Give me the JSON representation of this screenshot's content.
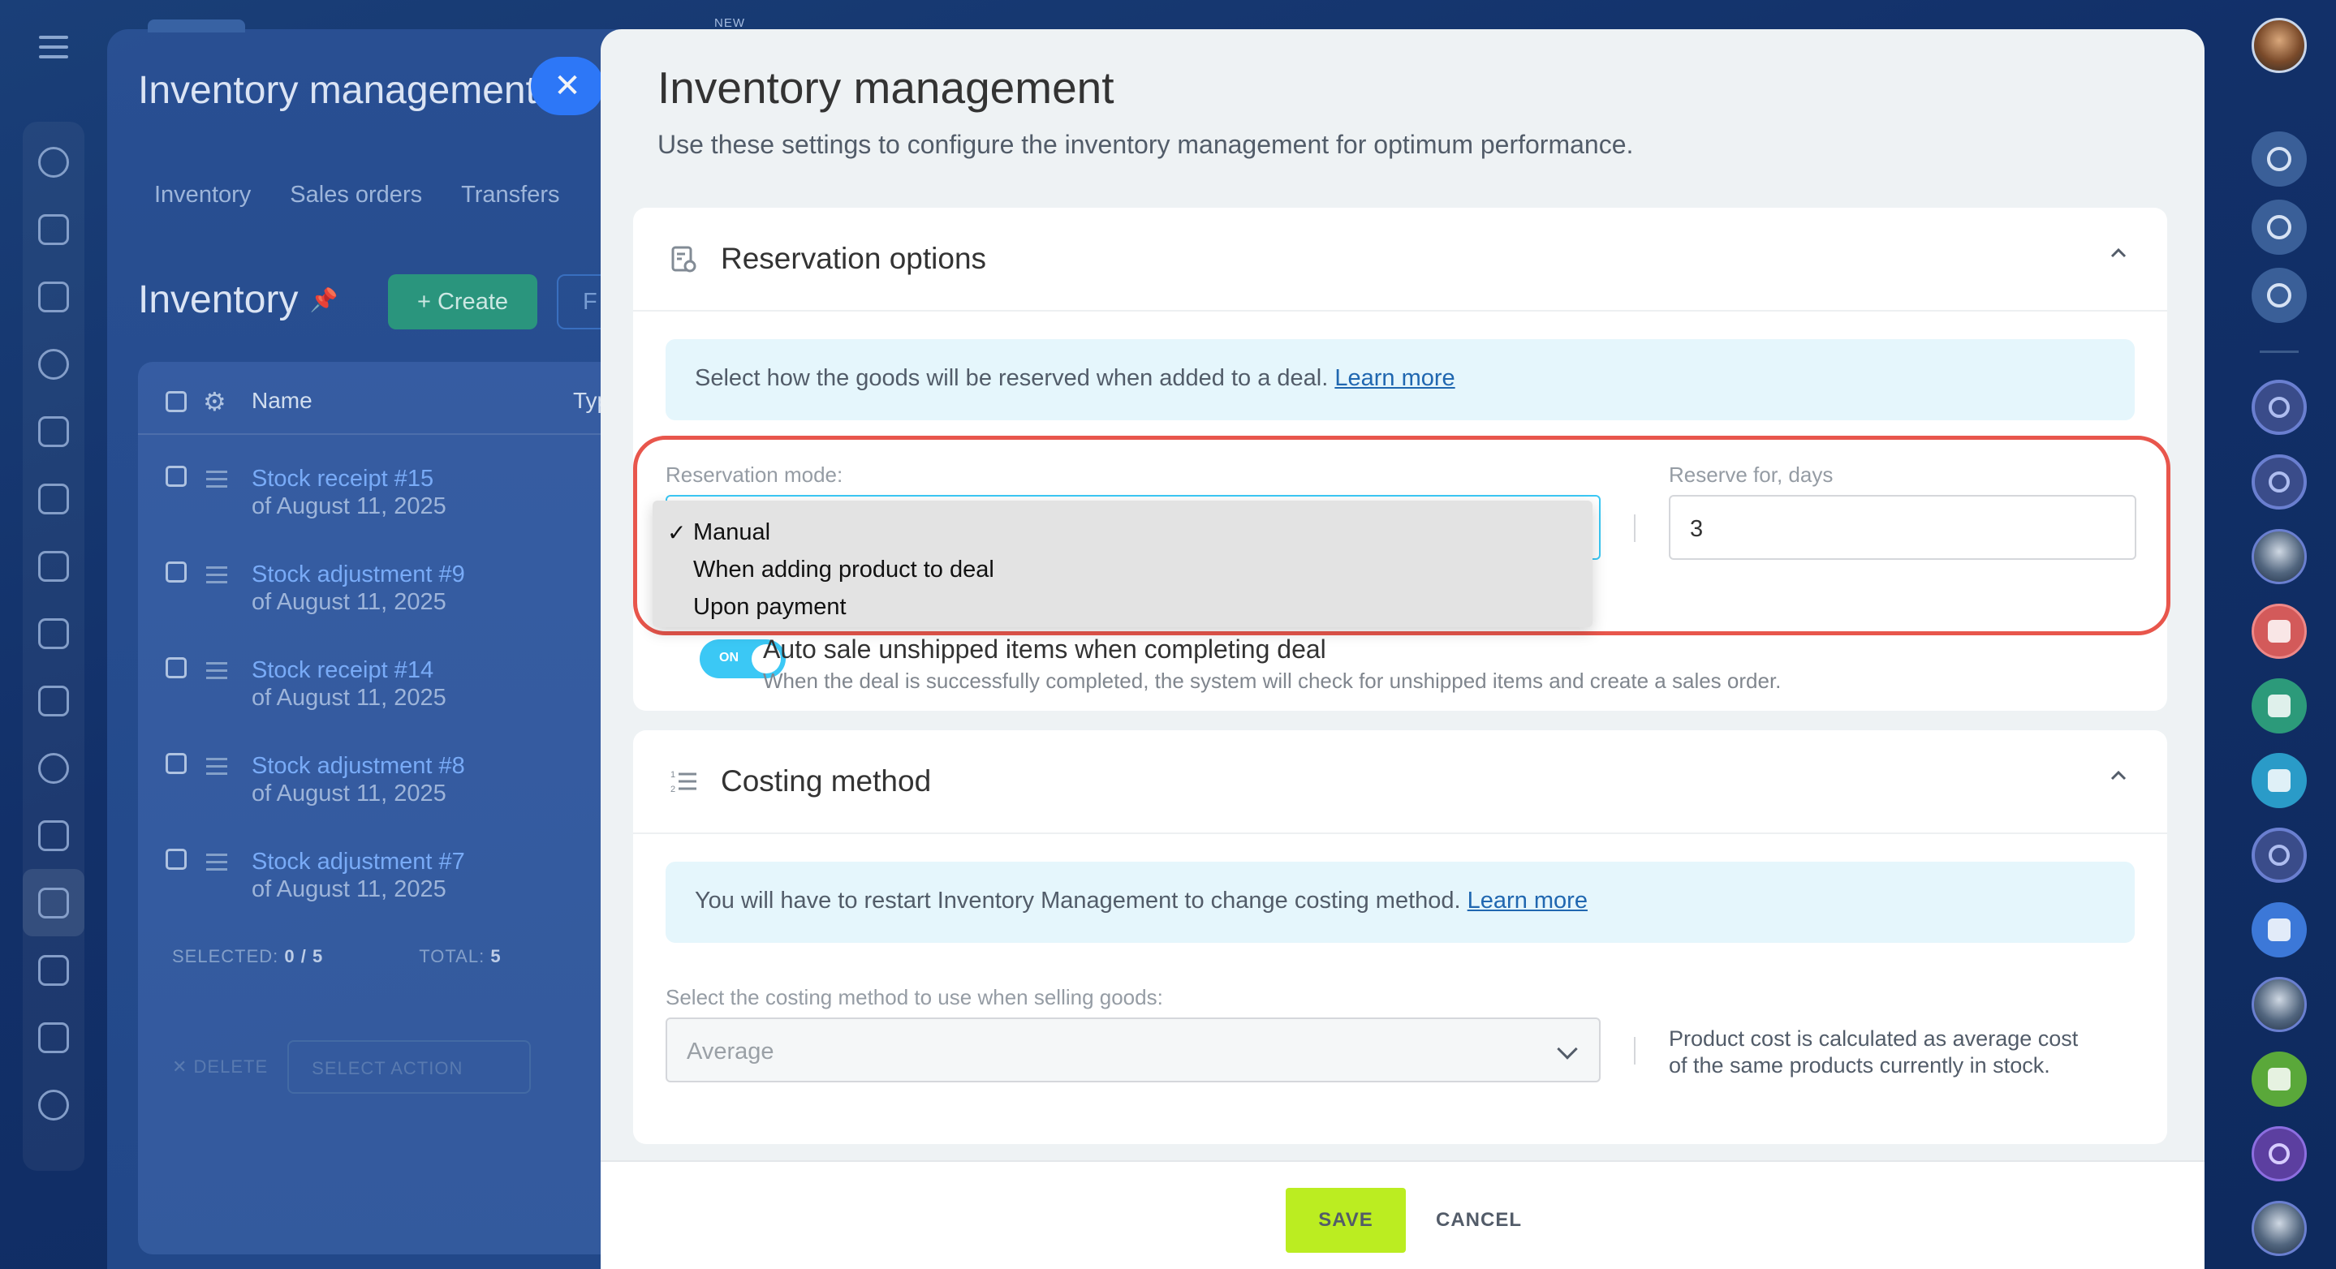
{
  "background": {
    "new_label": "NEW",
    "app_title": "Inventory management",
    "tabs": [
      "Inventory",
      "Sales orders",
      "Transfers"
    ],
    "page_title": "Inventory",
    "create_label": "+ Create",
    "filter_label": "F",
    "table": {
      "col_name": "Name",
      "col_type": "Typ",
      "rows": [
        {
          "title": "Stock receipt #15",
          "date": "of August 11, 2025"
        },
        {
          "title": "Stock adjustment #9",
          "date": "of August 11, 2025"
        },
        {
          "title": "Stock receipt #14",
          "date": "of August 11, 2025"
        },
        {
          "title": "Stock adjustment #8",
          "date": "of August 11, 2025"
        },
        {
          "title": "Stock adjustment #7",
          "date": "of August 11, 2025"
        }
      ],
      "selected_label": "SELECTED:",
      "selected_value": "0 / 5",
      "total_label": "TOTAL:",
      "total_value": "5",
      "delete_label": "✕ DELETE",
      "select_action_label": "SELECT ACTION"
    }
  },
  "panel": {
    "title": "Inventory management",
    "subtitle": "Use these settings to configure the inventory management for optimum performance.",
    "reservation": {
      "title": "Reservation options",
      "info_text": "Select how the goods will be reserved when added to a deal.",
      "info_link": "Learn more",
      "mode_label": "Reservation mode:",
      "mode_options": [
        "Manual",
        "When adding product to deal",
        "Upon payment"
      ],
      "mode_selected": "Manual",
      "reserve_label": "Reserve for, days",
      "reserve_value": "3",
      "toggle_state": "ON",
      "toggle_title": "Auto sale unshipped items when completing deal",
      "toggle_desc": "When the deal is successfully completed, the system will check for unshipped items and create a sales order."
    },
    "costing": {
      "title": "Costing method",
      "info_text": "You will have to restart Inventory Management to change costing method.",
      "info_link": "Learn more",
      "select_label": "Select the costing method to use when selling goods:",
      "select_value": "Average",
      "note_line1": "Product cost is calculated as average cost",
      "note_line2": "of the same products currently in stock."
    },
    "footer": {
      "save_label": "SAVE",
      "cancel_label": "CANCEL"
    }
  },
  "colors": {
    "accent_save": "#bbed21",
    "highlight_border": "#e8564c",
    "link": "#2067b0",
    "toggle": "#3bc8f5"
  }
}
